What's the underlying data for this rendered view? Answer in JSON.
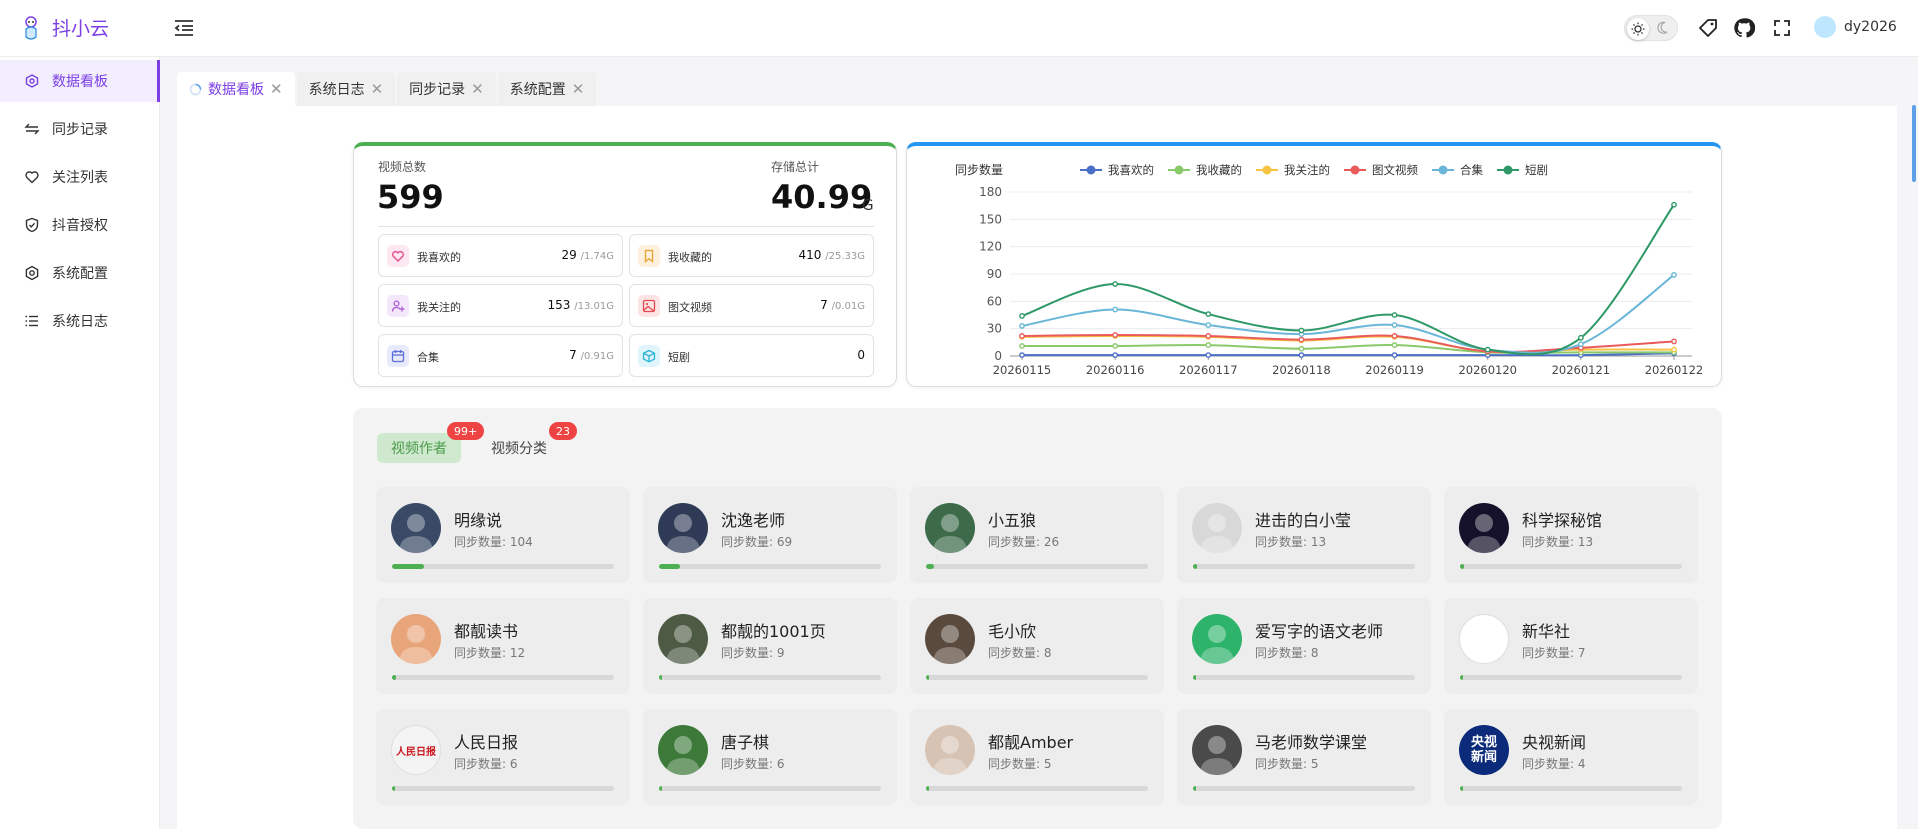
{
  "app": {
    "title": "抖小云"
  },
  "header": {
    "user_name": "dy2026"
  },
  "sidebar": {
    "items": [
      {
        "label": "数据看板",
        "icon": "dashboard-icon",
        "active": true
      },
      {
        "label": "同步记录",
        "icon": "sync-icon",
        "active": false
      },
      {
        "label": "关注列表",
        "icon": "heart-icon",
        "active": false
      },
      {
        "label": "抖音授权",
        "icon": "shield-icon",
        "active": false
      },
      {
        "label": "系统配置",
        "icon": "gear-icon",
        "active": false
      },
      {
        "label": "系统日志",
        "icon": "list-icon",
        "active": false
      }
    ]
  },
  "tabs": [
    {
      "label": "数据看板",
      "active": true
    },
    {
      "label": "系统日志",
      "active": false
    },
    {
      "label": "同步记录",
      "active": false
    },
    {
      "label": "系统配置",
      "active": false
    }
  ],
  "stats": {
    "total_label": "视频总数",
    "total_value": "599",
    "storage_label": "存储总计",
    "storage_value": "40.99",
    "storage_unit": "G",
    "items": [
      {
        "label": "我喜欢的",
        "count": "29",
        "size": "/1.74G",
        "icon": "heart-icon",
        "color": "#e54d8f"
      },
      {
        "label": "我收藏的",
        "count": "410",
        "size": "/25.33G",
        "icon": "bookmark-icon",
        "color": "#e8a53a"
      },
      {
        "label": "我关注的",
        "count": "153",
        "size": "/13.01G",
        "icon": "user-plus-icon",
        "color": "#b05bd6"
      },
      {
        "label": "图文视频",
        "count": "7",
        "size": "/0.01G",
        "icon": "image-icon",
        "color": "#e5484d"
      },
      {
        "label": "合集",
        "count": "7",
        "size": "/0.91G",
        "icon": "calendar-icon",
        "color": "#5b6fd6"
      },
      {
        "label": "短剧",
        "count": "0",
        "size": "",
        "icon": "cube-icon",
        "color": "#2bb4d4"
      }
    ]
  },
  "chart_data": {
    "type": "line",
    "ylabel": "同步数量",
    "categories": [
      "20260115",
      "20260116",
      "20260117",
      "20260118",
      "20260119",
      "20260120",
      "20260121",
      "20260122"
    ],
    "ylim": [
      0,
      180
    ],
    "yticks": [
      0,
      30,
      60,
      90,
      120,
      150,
      180
    ],
    "legend_position": "top",
    "series": [
      {
        "name": "我喜欢的",
        "color": "#4a6fc7",
        "values": [
          1,
          1,
          1,
          1,
          1,
          1,
          1,
          3
        ]
      },
      {
        "name": "我收藏的",
        "color": "#8ac96a",
        "values": [
          11,
          11,
          12,
          8,
          12,
          4,
          4,
          4
        ]
      },
      {
        "name": "我关注的",
        "color": "#f6c343",
        "values": [
          21,
          22,
          21,
          17,
          21,
          5,
          7,
          7
        ]
      },
      {
        "name": "图文视频",
        "color": "#e95b5b",
        "values": [
          22,
          23,
          22,
          18,
          22,
          5,
          9,
          16
        ]
      },
      {
        "name": "合集",
        "color": "#6ab6d8",
        "values": [
          33,
          51,
          34,
          24,
          34,
          7,
          13,
          89
        ]
      },
      {
        "name": "短剧",
        "color": "#2e9966",
        "values": [
          44,
          79,
          46,
          28,
          45,
          7,
          20,
          166
        ]
      }
    ]
  },
  "authors_panel": {
    "tab_authors": "视频作者",
    "tab_authors_badge": "99+",
    "tab_categories": "视频分类",
    "tab_categories_badge": "23",
    "count_prefix": "同步数量: ",
    "authors": [
      {
        "name": "明缘说",
        "count": 104,
        "progress": 0.145,
        "avatar_color": "#3a4a66",
        "avatar_icon": "person-avatar-icon"
      },
      {
        "name": "沈逸老师",
        "count": 69,
        "progress": 0.096,
        "avatar_color": "#2f3a56",
        "avatar_icon": "person-avatar-icon"
      },
      {
        "name": "小五狼",
        "count": 26,
        "progress": 0.036,
        "avatar_color": "#3d6b4a",
        "avatar_icon": "cartoon-avatar-icon"
      },
      {
        "name": "进击的白小莹",
        "count": 13,
        "progress": 0.018,
        "avatar_color": "#d8d8d8",
        "avatar_icon": "cartoon-avatar-icon"
      },
      {
        "name": "科学探秘馆",
        "count": 13,
        "progress": 0.018,
        "avatar_color": "#16112a",
        "avatar_icon": "blackhole-avatar-icon"
      },
      {
        "name": "都靓读书",
        "count": 12,
        "progress": 0.017,
        "avatar_color": "#e9a57a",
        "avatar_icon": "person-avatar-icon"
      },
      {
        "name": "都靓的1001页",
        "count": 9,
        "progress": 0.013,
        "avatar_color": "#4d5a44",
        "avatar_icon": "person-avatar-icon"
      },
      {
        "name": "毛小欣",
        "count": 8,
        "progress": 0.011,
        "avatar_color": "#5a4a3e",
        "avatar_icon": "person-avatar-icon"
      },
      {
        "name": "爱写字的语文老师",
        "count": 8,
        "progress": 0.011,
        "avatar_color": "#2db36a",
        "avatar_icon": "cartoon-avatar-icon"
      },
      {
        "name": "新华社",
        "count": 7,
        "progress": 0.01,
        "avatar_color": "#ffffff",
        "avatar_icon": "emblem-avatar-icon"
      },
      {
        "name": "人民日报",
        "count": 6,
        "progress": 0.008,
        "avatar_color": "#f4f4f4",
        "avatar_icon": "logo-avatar-icon"
      },
      {
        "name": "唐子棋",
        "count": 6,
        "progress": 0.008,
        "avatar_color": "#3d7a3a",
        "avatar_icon": "person-avatar-icon"
      },
      {
        "name": "都靓Amber",
        "count": 5,
        "progress": 0.007,
        "avatar_color": "#d7c3b4",
        "avatar_icon": "person-avatar-icon"
      },
      {
        "name": "马老师数学课堂",
        "count": 5,
        "progress": 0.007,
        "avatar_color": "#4a4a4a",
        "avatar_icon": "person-avatar-icon"
      },
      {
        "name": "央视新闻",
        "count": 4,
        "progress": 0.006,
        "avatar_color": "#0c2a7a",
        "avatar_icon": "logo-avatar-icon"
      }
    ],
    "avatar_logo_text": {
      "cctv": "央视\n新闻",
      "peoples": "人民日报"
    }
  }
}
